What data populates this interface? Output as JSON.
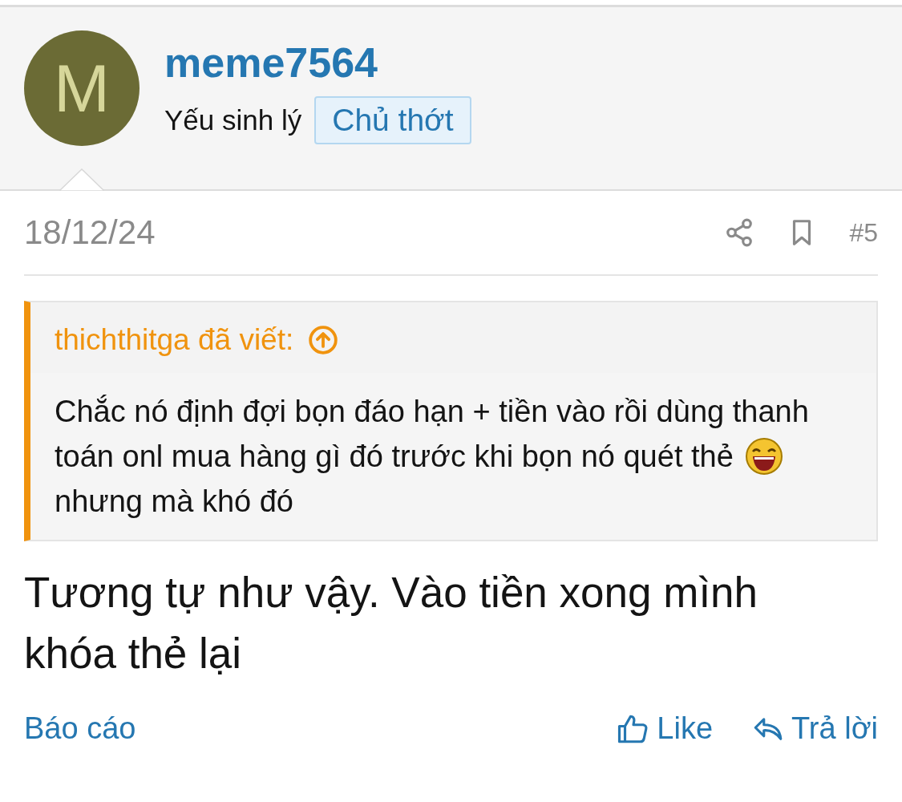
{
  "author": {
    "avatar_letter": "M",
    "username": "meme7564",
    "title": "Yếu sinh lý",
    "badge": "Chủ thớt"
  },
  "post": {
    "date": "18/12/24",
    "number": "#5",
    "quote": {
      "attribution": "thichthitga đã viết:",
      "lines": [
        {
          "text": "Chắc nó định đợi bọn đáo hạn + tiền vào rồi dùng thanh",
          "emoji_after": false
        },
        {
          "text": "toán onl mua hàng gì đó trước khi bọn nó quét thẻ",
          "emoji_after": true
        },
        {
          "text": "nhưng mà khó đó",
          "emoji_after": false
        }
      ]
    },
    "body": "Tương tự như vậy. Vào tiền xong mình khóa thẻ lại"
  },
  "actions": {
    "report": "Báo cáo",
    "like": "Like",
    "reply": "Trả lời"
  }
}
